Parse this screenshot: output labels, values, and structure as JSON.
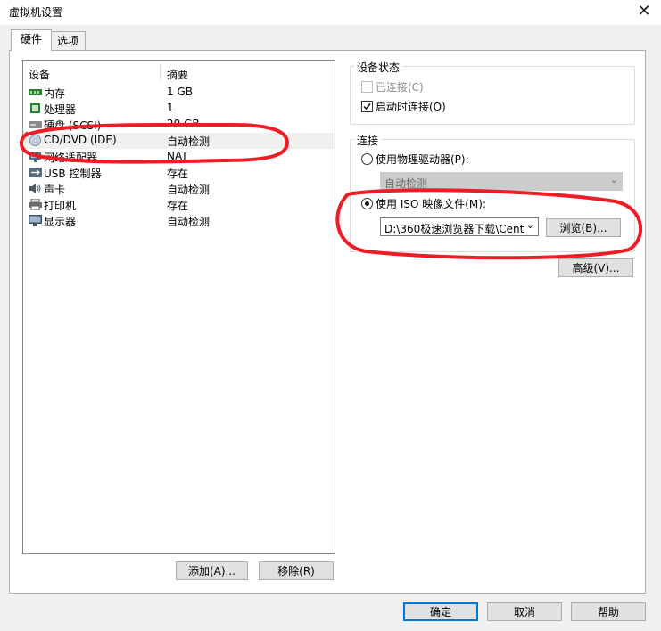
{
  "window": {
    "title": "虚拟机设置",
    "close_glyph": "✕"
  },
  "tabs": [
    {
      "label": "硬件",
      "active": true
    },
    {
      "label": "选项",
      "active": false
    }
  ],
  "device_list": {
    "columns": {
      "device": "设备",
      "summary": "摘要"
    },
    "rows": [
      {
        "name": "内存",
        "summary": "1 GB",
        "icon": "memory-icon"
      },
      {
        "name": "处理器",
        "summary": "1",
        "icon": "cpu-icon"
      },
      {
        "name": "硬盘 (SCSI)",
        "summary": "20 GB",
        "icon": "hard-disk-icon"
      },
      {
        "name": "CD/DVD (IDE)",
        "summary": "自动检测",
        "icon": "cd-dvd-icon",
        "selected": true
      },
      {
        "name": "网络适配器",
        "summary": "NAT",
        "icon": "network-adapter-icon"
      },
      {
        "name": "USB 控制器",
        "summary": "存在",
        "icon": "usb-icon"
      },
      {
        "name": "声卡",
        "summary": "自动检测",
        "icon": "sound-card-icon"
      },
      {
        "name": "打印机",
        "summary": "存在",
        "icon": "printer-icon"
      },
      {
        "name": "显示器",
        "summary": "自动检测",
        "icon": "display-icon"
      }
    ],
    "add_button": "添加(A)...",
    "remove_button": "移除(R)"
  },
  "device_status": {
    "title": "设备状态",
    "connected": {
      "label": "已连接(C)",
      "checked": false,
      "disabled": true
    },
    "connect_at_power_on": {
      "label": "启动时连接(O)",
      "checked": true
    }
  },
  "connection": {
    "title": "连接",
    "physical_drive": {
      "label": "使用物理驱动器(P):",
      "selected": false
    },
    "physical_drive_combo": "自动检测",
    "iso_image": {
      "label": "使用 ISO 映像文件(M):",
      "selected": true
    },
    "iso_path": "D:\\360极速浏览器下载\\Cent",
    "browse_button": "浏览(B)...",
    "advanced_button": "高级(V)..."
  },
  "footer": {
    "ok_button": "确定",
    "cancel_button": "取消",
    "help_button": "帮助"
  },
  "colors": {
    "annotation": "#ee1c25",
    "window_bg": "#f0f0f0",
    "focus_blue": "#0078d7"
  }
}
